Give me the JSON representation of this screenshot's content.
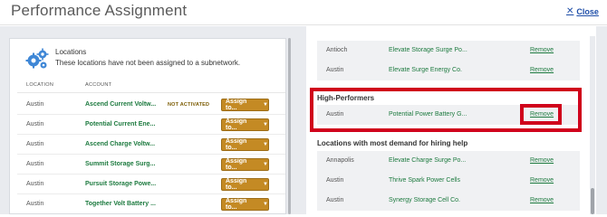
{
  "header": {
    "title": "Performance Assignment",
    "close_label": "Close"
  },
  "locations_panel": {
    "title": "Locations",
    "subtitle": "These locations have not been assigned to a subnetwork.",
    "columns": [
      "LOCATION",
      "ACCOUNT"
    ],
    "assign_label": "Assign to...",
    "rows": [
      {
        "location": "Austin",
        "account": "Ascend Current Voltw...",
        "badge": "NOT ACTIVATED"
      },
      {
        "location": "Austin",
        "account": "Potential Current Ene...",
        "badge": ""
      },
      {
        "location": "Austin",
        "account": "Ascend Charge Voltw...",
        "badge": ""
      },
      {
        "location": "Austin",
        "account": "Summit Storage Surg...",
        "badge": ""
      },
      {
        "location": "Austin",
        "account": "Pursuit Storage Powe...",
        "badge": ""
      },
      {
        "location": "Austin",
        "account": "Together Volt Battery ...",
        "badge": ""
      }
    ]
  },
  "subnetworks": {
    "remove_label": "Remove",
    "top_rows": [
      {
        "location": "Antioch",
        "account": "Elevate Storage Surge Po..."
      },
      {
        "location": "Austin",
        "account": "Elevate Surge Energy Co."
      }
    ],
    "high_performers": {
      "title": "High-Performers",
      "rows": [
        {
          "location": "Austin",
          "account": "Potential Power Battery G..."
        }
      ]
    },
    "demand": {
      "title": "Locations with most demand for hiring help",
      "rows": [
        {
          "location": "Annapolis",
          "account": "Elevate Charge Surge Po..."
        },
        {
          "location": "Austin",
          "account": "Thrive Spark Power Cells"
        },
        {
          "location": "Austin",
          "account": "Synergy Storage Cell Co."
        }
      ]
    }
  },
  "colors": {
    "accent_green": "#1d7a3f",
    "assign_button": "#c48a24",
    "highlight_red": "#d0021b"
  }
}
